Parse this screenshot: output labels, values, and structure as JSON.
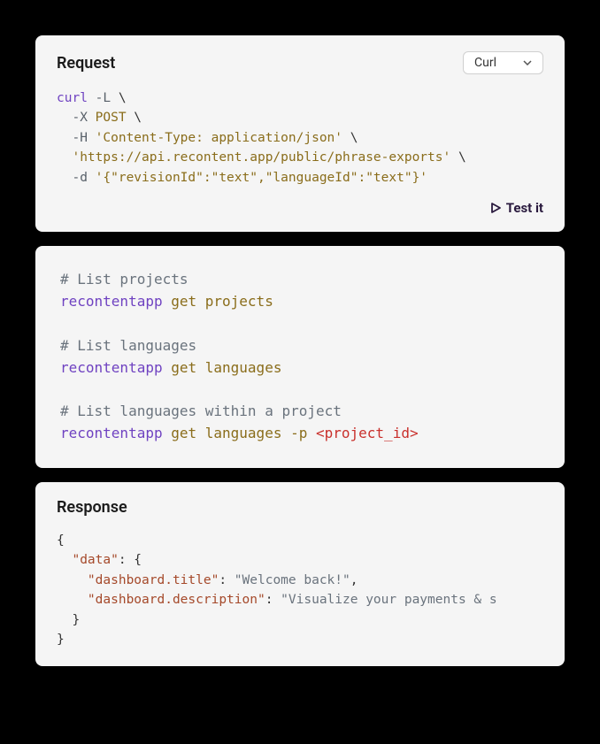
{
  "request": {
    "title": "Request",
    "dropdown": {
      "selected": "Curl"
    },
    "code": {
      "l1_cmd": "curl",
      "l1_flag": " -L",
      "l1_bs": " \\",
      "l2_flag": "  -X",
      "l2_arg": " POST",
      "l2_bs": " \\",
      "l3_flag": "  -H",
      "l3_str": " 'Content-Type: application/json'",
      "l3_bs": " \\",
      "l4_str": "  'https://api.recontent.app/public/phrase-exports'",
      "l4_bs": " \\",
      "l5_flag": "  -d",
      "l5_str": " '{\"revisionId\":\"text\",\"languageId\":\"text\"}'"
    },
    "test_label": "Test it"
  },
  "cli": {
    "l1_comment": "# List projects",
    "l2_cmd": "recontentapp",
    "l2_sub": " get",
    "l2_arg": " projects",
    "l3_comment": "# List languages",
    "l4_cmd": "recontentapp",
    "l4_sub": " get",
    "l4_arg": " languages",
    "l5_comment": "# List languages within a project",
    "l6_cmd": "recontentapp",
    "l6_sub": " get",
    "l6_arg": " languages",
    "l6_flag": " -p",
    "l6_param": " <project_id>"
  },
  "response": {
    "title": "Response",
    "code": {
      "l1": "{",
      "l2_k": "  \"data\"",
      "l2_p": ": {",
      "l3_k": "    \"dashboard.title\"",
      "l3_p": ": ",
      "l3_v": "\"Welcome back!\"",
      "l3_c": ",",
      "l4_k": "    \"dashboard.description\"",
      "l4_p": ": ",
      "l4_v": "\"Visualize your payments & s",
      "l5": "  }",
      "l6": "}"
    }
  }
}
